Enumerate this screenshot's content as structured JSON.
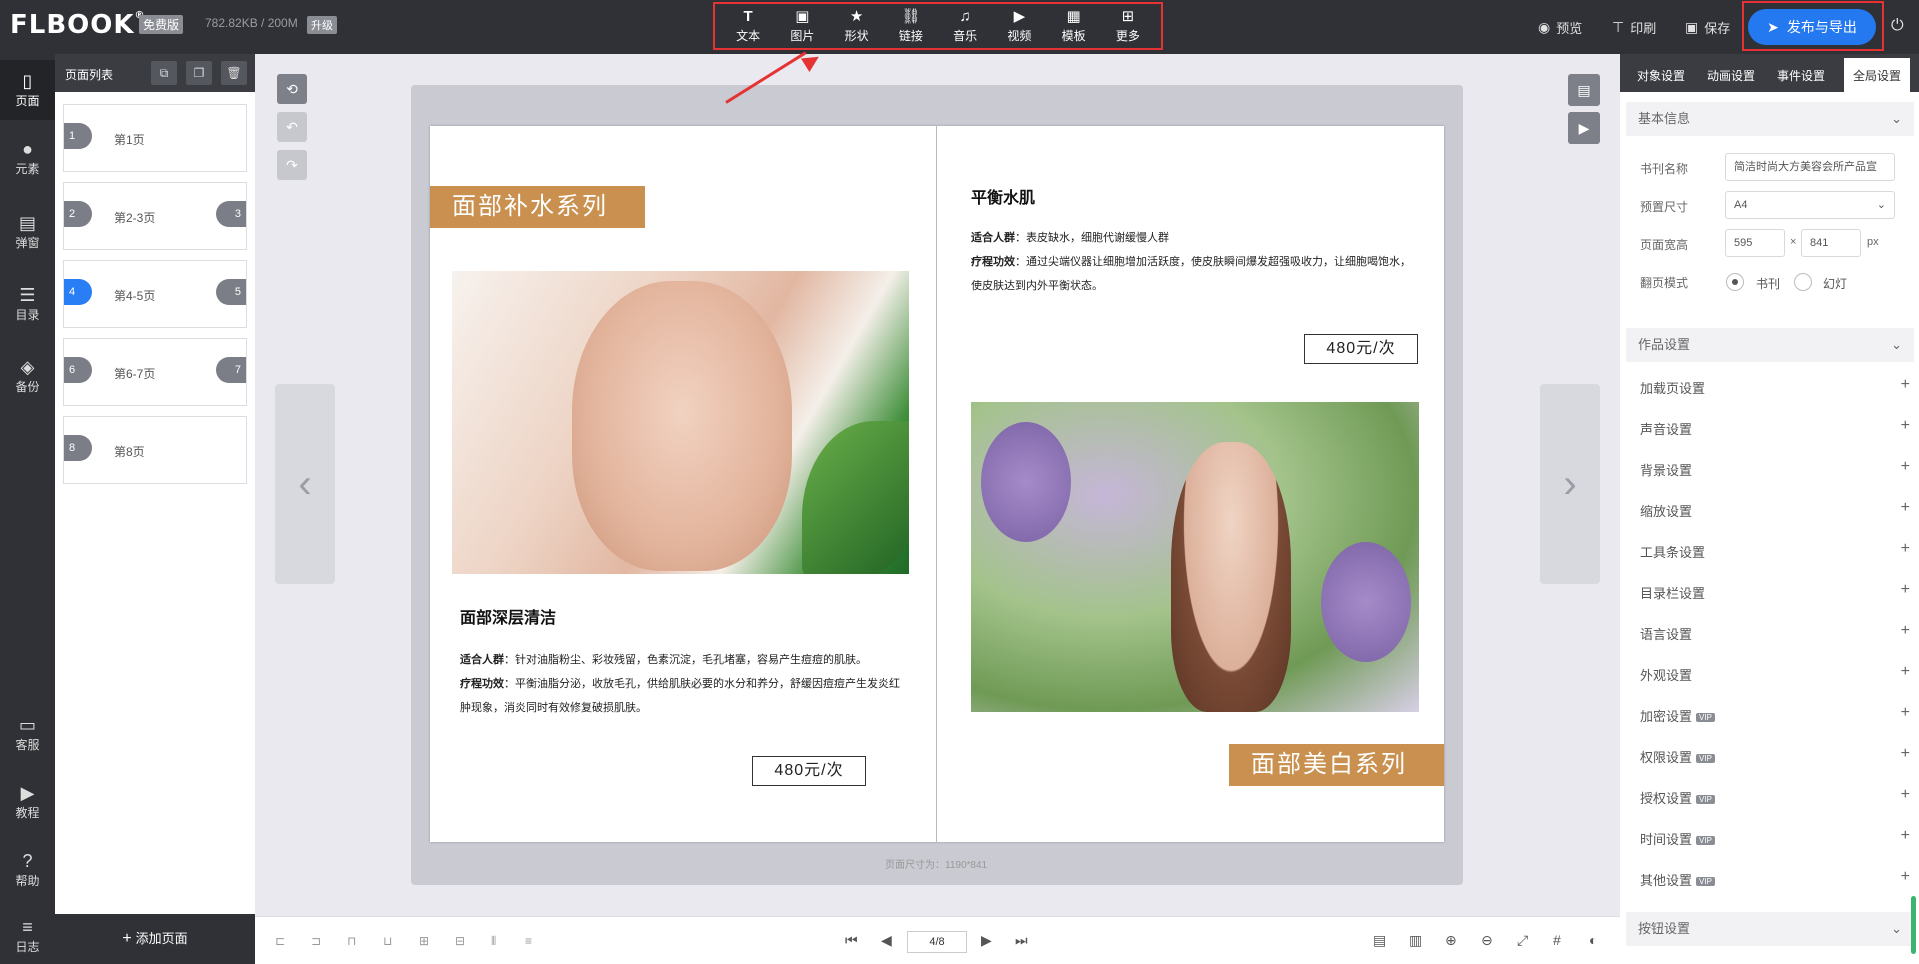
{
  "header": {
    "logo": "FLBOOK",
    "logo_mark": "®",
    "edition_badge": "免费版",
    "storage": "782.82KB / 200M",
    "upgrade_badge": "升级",
    "tools": [
      {
        "label": "文本",
        "icon": "T"
      },
      {
        "label": "图片",
        "icon": "▣"
      },
      {
        "label": "形状",
        "icon": "★"
      },
      {
        "label": "链接",
        "icon": "⛓"
      },
      {
        "label": "音乐",
        "icon": "♫"
      },
      {
        "label": "视频",
        "icon": "▶"
      },
      {
        "label": "模板",
        "icon": "▦"
      },
      {
        "label": "更多",
        "icon": "⊞"
      }
    ],
    "preview": "预览",
    "print": "印刷",
    "save": "保存",
    "publish": "发布与导出"
  },
  "leftnav": [
    {
      "label": "页面",
      "icon": "▯"
    },
    {
      "label": "元素",
      "icon": "●"
    },
    {
      "label": "弹窗",
      "icon": "▤"
    },
    {
      "label": "目录",
      "icon": "☰"
    },
    {
      "label": "备份",
      "icon": "◈"
    },
    {
      "label": "客服",
      "icon": "▭"
    },
    {
      "label": "教程",
      "icon": "▶"
    },
    {
      "label": "帮助",
      "icon": "?"
    },
    {
      "label": "日志",
      "icon": "≡"
    }
  ],
  "pagelist": {
    "title": "页面列表",
    "pages": [
      {
        "num": "1",
        "label": "第1页",
        "right": ""
      },
      {
        "num": "2",
        "label": "第2-3页",
        "right": "3"
      },
      {
        "num": "4",
        "label": "第4-5页",
        "right": "5"
      },
      {
        "num": "6",
        "label": "第6-7页",
        "right": "7"
      },
      {
        "num": "8",
        "label": "第8页",
        "right": ""
      }
    ],
    "add_page": "添加页面"
  },
  "book": {
    "left": {
      "ribbon": "面部补水系列",
      "title": "面部深层清洁",
      "fit_label": "适合人群",
      "fit_text": "：针对油脂粉尘、彩妆残留，色素沉淀，毛孔堵塞，容易产生痘痘的肌肤。",
      "effect_label": "疗程功效",
      "effect_text": "：平衡油脂分泌，收放毛孔，供给肌肤必要的水分和养分，舒缓因痘痘产生发炎红肿现象，消炎同时有效修复破损肌肤。",
      "price": "480元/次"
    },
    "right": {
      "title": "平衡水肌",
      "fit_label": "适合人群",
      "fit_text": "：表皮缺水，细胞代谢缓慢人群",
      "effect_label": "疗程功效",
      "effect_text": "：通过尖端仪器让细胞增加活跃度，使皮肤瞬间爆发超强吸收力，让细胞喝饱水，使皮肤达到内外平衡状态。",
      "price": "480元/次",
      "ribbon": "面部美白系列"
    },
    "size_note": "页面尺寸为：1190*841"
  },
  "pager": {
    "value": "4/8"
  },
  "rpanel": {
    "tabs": [
      "对象设置",
      "动画设置",
      "事件设置",
      "全局设置"
    ],
    "basic_title": "基本信息",
    "book_name_label": "书刊名称",
    "book_name_value": "简洁时尚大方美容会所产品宣",
    "preset_label": "预置尺寸",
    "preset_value": "A4",
    "size_label": "页面宽高",
    "width": "595",
    "height": "841",
    "times": "×",
    "unit": "px",
    "flip_label": "翻页模式",
    "flip_book": "书刊",
    "flip_slide": "幻灯",
    "work_title": "作品设置",
    "settings": [
      {
        "label": "加载页设置",
        "vip": ""
      },
      {
        "label": "声音设置",
        "vip": ""
      },
      {
        "label": "背景设置",
        "vip": ""
      },
      {
        "label": "缩放设置",
        "vip": ""
      },
      {
        "label": "工具条设置",
        "vip": ""
      },
      {
        "label": "目录栏设置",
        "vip": ""
      },
      {
        "label": "语言设置",
        "vip": ""
      },
      {
        "label": "外观设置",
        "vip": ""
      },
      {
        "label": "加密设置",
        "vip": "VIP"
      },
      {
        "label": "权限设置",
        "vip": "VIP"
      },
      {
        "label": "授权设置",
        "vip": "VIP"
      },
      {
        "label": "时间设置",
        "vip": "VIP"
      },
      {
        "label": "其他设置",
        "vip": "VIP"
      }
    ],
    "button_title": "按钮设置"
  },
  "colors": {
    "accent": "#2479f0",
    "ribbon": "#c9904f",
    "highlight": "#e53333",
    "dark": "#2f3136"
  }
}
